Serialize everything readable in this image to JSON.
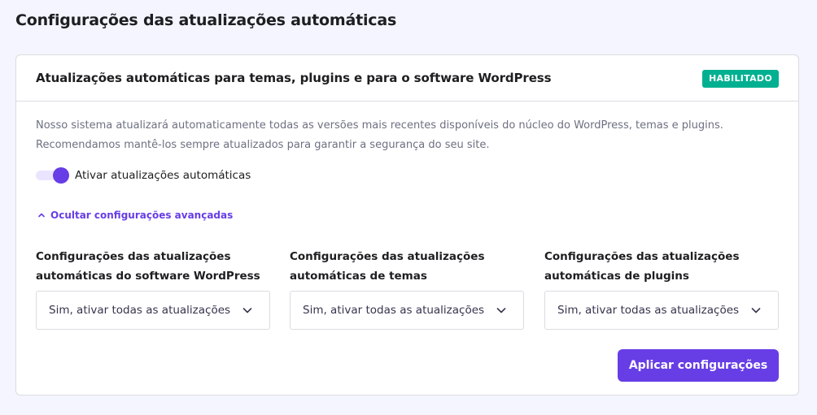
{
  "page": {
    "title": "Configurações das atualizações automáticas"
  },
  "card": {
    "title": "Atualizações automáticas para temas, plugins e para o software WordPress",
    "badge": "HABILITADO",
    "description_line1": "Nosso sistema atualizará automaticamente todas as versões mais recentes disponíveis do núcleo do WordPress, temas e plugins.",
    "description_line2": "Recomendamos mantê-los sempre atualizados para garantir a segurança do seu site.",
    "toggle": {
      "label": "Ativar atualizações automáticas",
      "enabled": true
    },
    "advanced_link": "Ocultar configurações avançadas",
    "settings": [
      {
        "label_line1": "Configurações das atualizações",
        "label_line2": "automáticas do software WordPress",
        "selected": "Sim, ativar todas as atualizações"
      },
      {
        "label_line1": "Configurações das atualizações",
        "label_line2": "automáticas de temas",
        "selected": "Sim, ativar todas as atualizações"
      },
      {
        "label_line1": "Configurações das atualizações",
        "label_line2": "automáticas de plugins",
        "selected": "Sim, ativar todas as atualizações"
      }
    ],
    "apply_button": "Aplicar configurações"
  },
  "colors": {
    "accent": "#673de6",
    "badge": "#00b090",
    "background": "#f4f5ff"
  },
  "icons": {
    "advanced_link": "chevron-up-icon",
    "select_arrow": "chevron-down-icon"
  }
}
